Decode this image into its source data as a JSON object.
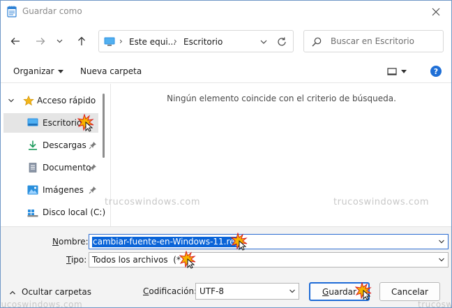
{
  "window": {
    "title": "Guardar como"
  },
  "address": {
    "crumbs": [
      "Este equi...",
      "Escritorio"
    ]
  },
  "search": {
    "placeholder": "Buscar en Escritorio"
  },
  "commandbar": {
    "organize": "Organizar",
    "new_folder": "Nueva carpeta",
    "help": "?"
  },
  "sidebar": {
    "items": [
      {
        "label": "Acceso rápido",
        "icon": "star-icon"
      },
      {
        "label": "Escritorio",
        "icon": "desktop-icon"
      },
      {
        "label": "Descargas",
        "icon": "download-icon"
      },
      {
        "label": "Documento",
        "icon": "document-icon"
      },
      {
        "label": "Imágenes",
        "icon": "pictures-icon"
      },
      {
        "label": "Disco local (C:)",
        "icon": "drive-icon"
      }
    ]
  },
  "content": {
    "empty_message": "Ningún elemento coincide con el criterio de búsqueda.",
    "watermark": "trucoswindows.com"
  },
  "form": {
    "name_label_u": "N",
    "name_label_rest": "ombre:",
    "name_value": "cambiar-fuente-en-Windows-11.reg",
    "type_label_u": "T",
    "type_label_rest": "ipo:",
    "type_value": "Todos los archivos  (*.*)",
    "encoding_label_u": "C",
    "encoding_label_rest": "odificación:",
    "encoding_value": "UTF-8",
    "hide_folders": "Ocultar carpetas",
    "save_u": "G",
    "save_rest": "uardar",
    "cancel": "Cancelar"
  },
  "colors": {
    "accent": "#1d6bd6",
    "selection": "#0a64d8",
    "sidebar_selected": "#e5e5e5",
    "footer_bg": "#f3f3f3"
  }
}
